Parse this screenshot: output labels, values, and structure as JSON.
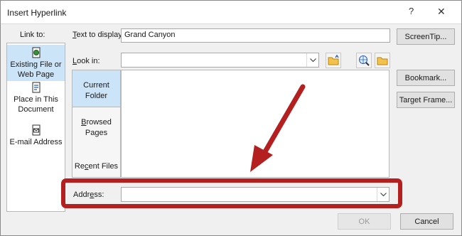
{
  "window": {
    "title": "Insert Hyperlink",
    "help_glyph": "?",
    "close_glyph": "✕"
  },
  "link_to": {
    "label": "Link to:",
    "items": [
      {
        "label_line1": "Existing File or",
        "label_line2": "Web Page",
        "icon": "web-page-icon",
        "selected": true
      },
      {
        "label_line1": "Place in This",
        "label_line2": "Document",
        "icon": "document-icon",
        "selected": false
      },
      {
        "label_line1": "E-mail Address",
        "label_line2": "",
        "icon": "email-icon",
        "selected": false
      }
    ]
  },
  "text_to_display": {
    "label": "Text to display:",
    "value": "Grand Canyon"
  },
  "screentip_button": "ScreenTip...",
  "look_in": {
    "label": "Look in:",
    "value": "",
    "icons": [
      "up-folder-icon",
      "browse-web-icon",
      "browse-file-icon"
    ]
  },
  "look_in_tabs": [
    {
      "line1": "Current",
      "line2": "Folder",
      "selected": true
    },
    {
      "line1": "Browsed",
      "line2": "Pages",
      "selected": false
    },
    {
      "line1": "Recent Files",
      "line2": "",
      "selected": false
    }
  ],
  "side_buttons": {
    "bookmark": "Bookmark...",
    "target_frame": "Target Frame..."
  },
  "address": {
    "label": "Address:",
    "value": ""
  },
  "footer": {
    "ok": "OK",
    "cancel": "Cancel"
  },
  "colors": {
    "highlight": "#b3201f",
    "selection": "#cce4f7"
  }
}
